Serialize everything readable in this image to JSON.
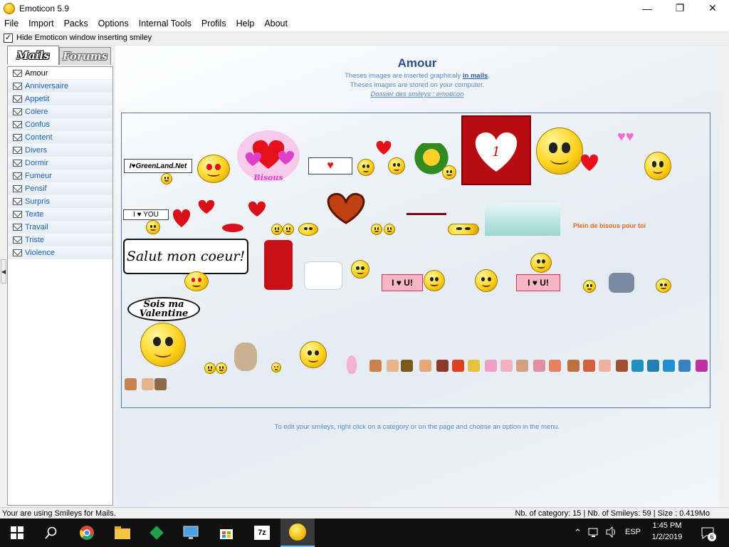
{
  "window": {
    "title": "Emoticon 5.9"
  },
  "menu": [
    "File",
    "Import",
    "Packs",
    "Options",
    "Internal Tools",
    "Profils",
    "Help",
    "About"
  ],
  "options": {
    "hide_label": "Hide Emoticon window inserting smiley",
    "hide_checked": true
  },
  "tabs": {
    "mails": "Mails",
    "forums": "Forums"
  },
  "categories": [
    "Amour",
    "Anniversaire",
    "Appetit",
    "Colere",
    "Confus",
    "Content",
    "Divers",
    "Dormir",
    "Fumeur",
    "Pensif",
    "Surpris",
    "Texte",
    "Travail",
    "Triste",
    "Violence"
  ],
  "selected_category": "Amour",
  "page": {
    "title": "Amour",
    "line1_text": "Theses images are inserted graphicaly ",
    "line1_link": "in mails",
    "line1_end": ".",
    "line2": "Theses images are stored on your computer.",
    "line3": "Dossier des smileys : emoticon",
    "hint": "To edit your smileys, right click on a category or on the page and choose an option in the menu."
  },
  "smileys": {
    "greenland": "I♥GreenLand.Net",
    "bisous": "Bisous",
    "heart_number": "1",
    "i_love_you": "I ♥ YOU",
    "plein": "Plein de bisous pour toi",
    "salut": "Salut mon coeur!",
    "i_love_u": "I ♥ U!",
    "sois_ma": "Sois ma",
    "valentine": "Valentine"
  },
  "status": {
    "left": "Your are using Smileys for Mails.",
    "right": "Nb. of category: 15 | Nb. of Smileys: 59 | Size : 0.419Mo"
  },
  "taskbar": {
    "lang": "ESP",
    "time": "1:45 PM",
    "date": "1/2/2019",
    "notif_count": "6",
    "zip_label": "7z"
  }
}
